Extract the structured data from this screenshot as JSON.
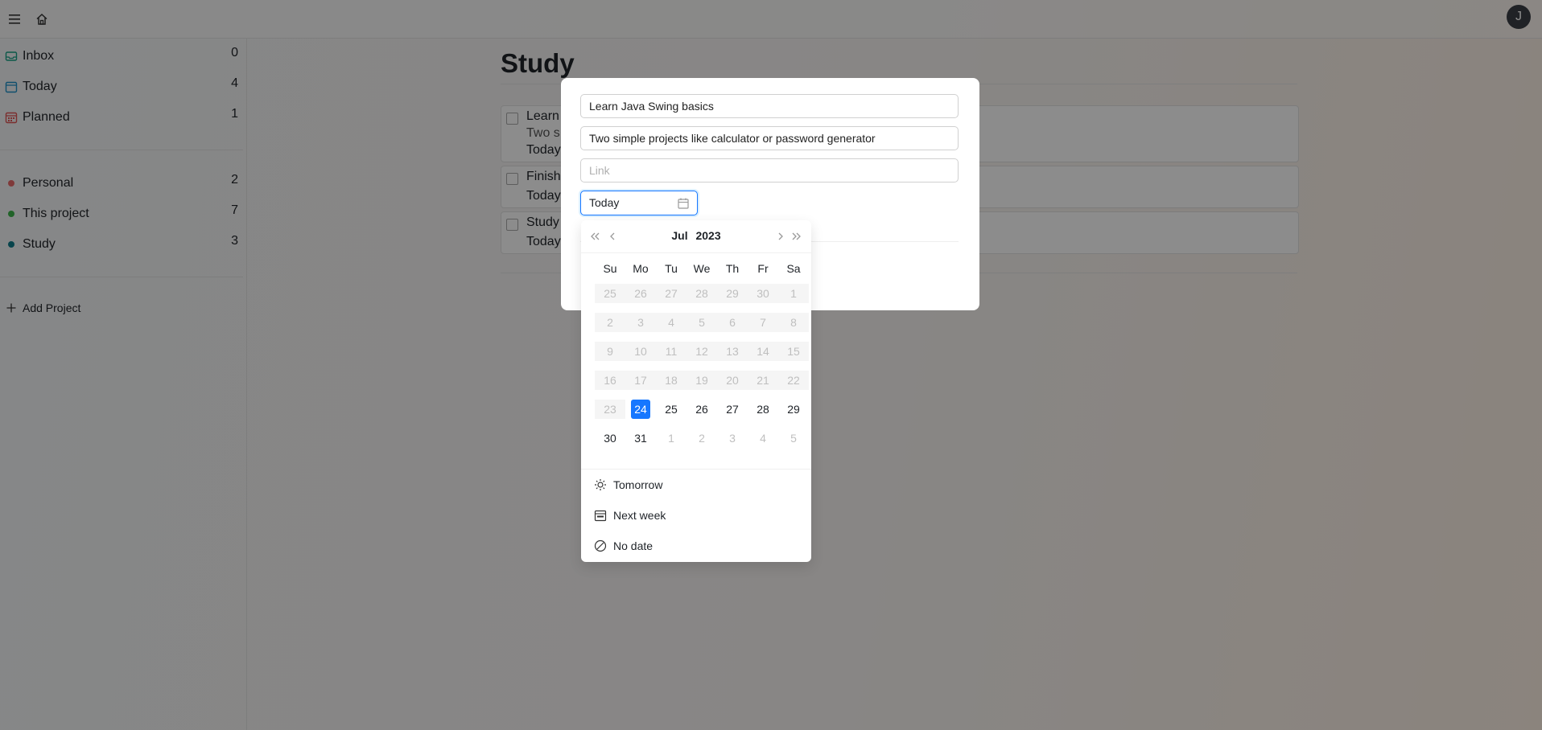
{
  "topbar": {
    "menu_icon": "menu-icon",
    "home_icon": "home-icon",
    "avatar_initial": "J"
  },
  "sidebar": {
    "items": [
      {
        "label": "Inbox",
        "count": "0",
        "icon": "inbox-icon",
        "color": "#16a085"
      },
      {
        "label": "Today",
        "count": "4",
        "icon": "calendar-today-icon",
        "color": "#1e90c8"
      },
      {
        "label": "Planned",
        "count": "1",
        "icon": "calendar-planned-icon",
        "color": "#e05555"
      }
    ],
    "projects": [
      {
        "label": "Personal",
        "count": "2",
        "color": "#e86b6b"
      },
      {
        "label": "This project",
        "count": "7",
        "color": "#3cb44b"
      },
      {
        "label": "Study",
        "count": "3",
        "color": "#0f7d8a"
      }
    ],
    "add_project": "Add Project"
  },
  "main": {
    "title": "Study",
    "tasks": [
      {
        "title": "Learn",
        "desc": "Two s",
        "due": "Today"
      },
      {
        "title": "Finish",
        "due": "Today"
      },
      {
        "title": "Study",
        "due": "Today"
      }
    ]
  },
  "modal": {
    "title_value": "Learn Java Swing basics",
    "desc_value": "Two simple projects like calculator or password generator",
    "link_placeholder": "Link",
    "date_value": "Today"
  },
  "picker": {
    "month": "Jul",
    "year": "2023",
    "weekdays": [
      "Su",
      "Mo",
      "Tu",
      "We",
      "Th",
      "Fr",
      "Sa"
    ],
    "weeks": [
      [
        "25",
        "26",
        "27",
        "28",
        "29",
        "30",
        "1"
      ],
      [
        "2",
        "3",
        "4",
        "5",
        "6",
        "7",
        "8"
      ],
      [
        "9",
        "10",
        "11",
        "12",
        "13",
        "14",
        "15"
      ],
      [
        "16",
        "17",
        "18",
        "19",
        "20",
        "21",
        "22"
      ],
      [
        "23",
        "24",
        "25",
        "26",
        "27",
        "28",
        "29"
      ],
      [
        "30",
        "31",
        "1",
        "2",
        "3",
        "4",
        "5"
      ]
    ],
    "selected": "24",
    "accent": "#1677ff",
    "presets": [
      {
        "label": "Tomorrow",
        "icon": "sun-icon"
      },
      {
        "label": "Next week",
        "icon": "calendar-week-icon"
      },
      {
        "label": "No date",
        "icon": "no-date-icon"
      }
    ]
  }
}
